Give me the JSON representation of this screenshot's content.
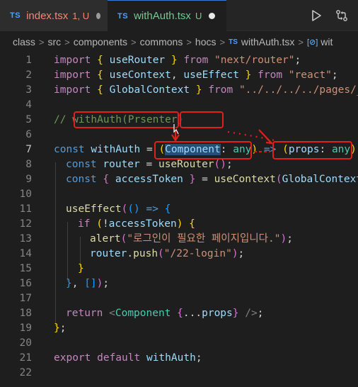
{
  "tabs": [
    {
      "badge": "TS",
      "name": "index.tsx",
      "status": "1, U",
      "state": "inactive"
    },
    {
      "badge": "TS",
      "name": "withAuth.tsx",
      "status": "U",
      "state": "active"
    }
  ],
  "tab_actions": {
    "run_icon": "play-icon",
    "compare_icon": "git-compare-icon"
  },
  "breadcrumb": {
    "parts": [
      "class",
      "src",
      "components",
      "commons",
      "hocs"
    ],
    "file_badge": "TS",
    "file": "withAuth.tsx",
    "symbol_icon": "[⊘]",
    "symbol": "wit"
  },
  "editor": {
    "current_line": 7,
    "lines": [
      {
        "n": "1"
      },
      {
        "n": "2"
      },
      {
        "n": "3"
      },
      {
        "n": "4"
      },
      {
        "n": "5"
      },
      {
        "n": "6"
      },
      {
        "n": "7"
      },
      {
        "n": "8"
      },
      {
        "n": "9"
      },
      {
        "n": "10"
      },
      {
        "n": "11"
      },
      {
        "n": "12"
      },
      {
        "n": "13"
      },
      {
        "n": "14"
      },
      {
        "n": "15"
      },
      {
        "n": "16"
      },
      {
        "n": "17"
      },
      {
        "n": "18"
      },
      {
        "n": "19"
      },
      {
        "n": "20"
      },
      {
        "n": "21"
      },
      {
        "n": "22"
      }
    ],
    "code": {
      "l1": {
        "kw": "import",
        "open": " { ",
        "name": "useRouter",
        "close": " } ",
        "from": "from",
        "src": " \"next/router\"",
        "end": ";"
      },
      "l2": {
        "kw": "import",
        "open": " { ",
        "name1": "useContext",
        "comma": ", ",
        "name2": "useEffect",
        "close": " } ",
        "from": "from",
        "src": " \"react\"",
        "end": ";"
      },
      "l3": {
        "kw": "import",
        "open": " { ",
        "name": "GlobalContext",
        "close": " } ",
        "from": "from",
        "src": " \"../../../../pages/_a"
      },
      "l5": {
        "comment": "// withAuth(Prsenter)"
      },
      "l7": {
        "kw": "const",
        "name": " withAuth",
        "eq": " = ",
        "p1": "(",
        "param": "Component",
        "colon": ": ",
        "ptype": "any",
        "p2": ")",
        "arrow": " => ",
        "p3": "(",
        "param2": "props",
        "colon2": ": ",
        "ptype2": "any",
        "p4": ")",
        "tail": " =>"
      },
      "l8": {
        "kw": "const",
        "name": " router",
        "eq": " = ",
        "fn": "useRouter",
        "call": "()",
        "end": ";"
      },
      "l9": {
        "kw": "const",
        "open": " { ",
        "name": "accessToken",
        "close": " } ",
        "eq": "= ",
        "fn": "useContext",
        "p1": "(",
        "arg": "GlobalContext",
        "p2": ")",
        "end": ";"
      },
      "l11": {
        "fn": "useEffect",
        "p1": "(",
        "p2": "()",
        "arrow": " => ",
        "b": "{"
      },
      "l12": {
        "kw": "if",
        "sp": " ",
        "p1": "(",
        "bang": "!",
        "name": "accessToken",
        "p2": ")",
        "sp2": " ",
        "b": "{"
      },
      "l13": {
        "fn": "alert",
        "p1": "(",
        "str": "\"로그인이 필요한 페이지입니다.\"",
        "p2": ")",
        "end": ";"
      },
      "l14": {
        "obj": "router",
        "dot": ".",
        "fn": "push",
        "p1": "(",
        "str": "\"/22-login\"",
        "p2": ")",
        "end": ";"
      },
      "l15": {
        "b": "}"
      },
      "l16": {
        "b": "}",
        "comma": ", ",
        "arr": "[]",
        "p": ")",
        "end": ";"
      },
      "l18": {
        "kw": "return",
        "sp": " ",
        "lt": "<",
        "tag": "Component",
        "sp2": " ",
        "b1": "{",
        "spread": "...",
        "props": "props",
        "b2": "}",
        "close": " />",
        "end": ";"
      },
      "l19": {
        "b": "}",
        "end": ";"
      },
      "l21": {
        "kw1": "export",
        "kw2": " default",
        "name": " withAuth",
        "end": ";"
      }
    }
  },
  "colors": {
    "annotation": "#e0201a",
    "keyword": "#569cd6",
    "string": "#ce9178",
    "variable": "#9cdcfe"
  }
}
